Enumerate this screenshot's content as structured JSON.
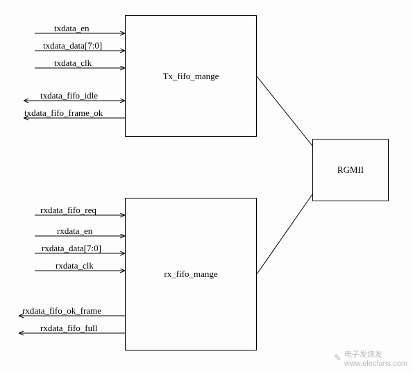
{
  "blocks": {
    "tx": {
      "label": "Tx_fifo_mange"
    },
    "rx": {
      "label": "rx_fifo_mange"
    },
    "rgmii": {
      "label": "RGMII"
    }
  },
  "signals": {
    "tx_in": [
      {
        "name": "txdata_en"
      },
      {
        "name": "txdata_data[7:0]"
      },
      {
        "name": "txdata_clk"
      }
    ],
    "tx_out": [
      {
        "name": "txdata_fifo_idle"
      },
      {
        "name": "txdata_fifo_frame_ok"
      }
    ],
    "rx_in": [
      {
        "name": "rxdata_fifo_req"
      },
      {
        "name": "rxdata_en"
      },
      {
        "name": "rxdata_data[7:0]"
      },
      {
        "name": "rxdata_clk"
      }
    ],
    "rx_out": [
      {
        "name": "rxdata_fifo_ok_frame"
      },
      {
        "name": "rxdata_fifo_full"
      }
    ]
  },
  "watermark": {
    "brand_cn": "电子发烧友",
    "url": "www.elecfans.com"
  }
}
